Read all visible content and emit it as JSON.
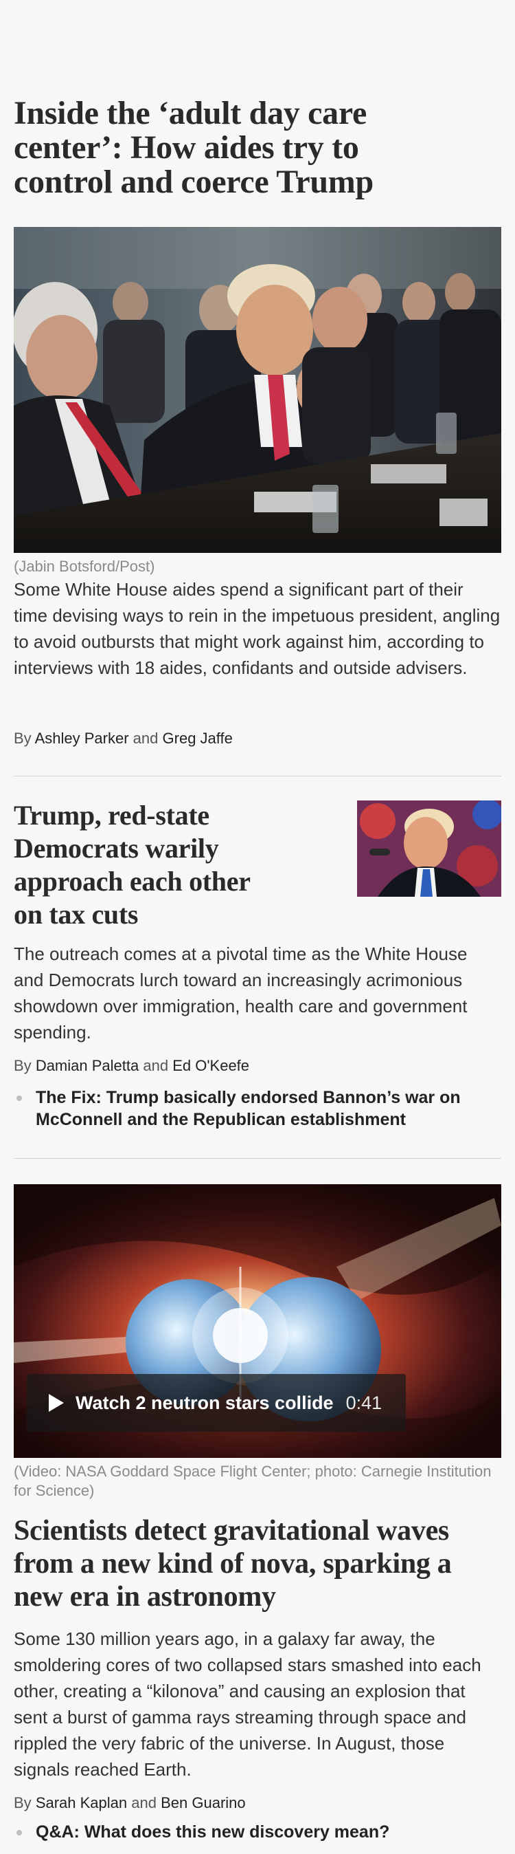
{
  "story1": {
    "headline": "Inside the ‘adult day care center’: How aides try to control and coerce Trump",
    "photo_caption": "(Jabin Botsford/Post)",
    "blurb": "Some White House aides spend a significant part of their time devising ways to rein in the impetuous president, angling to avoid outbursts that might work against him, according to interviews with 18 aides, confidants and outside advisers.",
    "byline_prefix": "By",
    "author1": "Ashley Parker",
    "conjunction": "and",
    "author2": "Greg Jaffe"
  },
  "story2": {
    "headline": "Trump, red-state Democrats warily approach each other on tax cuts",
    "blurb": "The outreach comes at a pivotal time as the White House and Democrats lurch toward an increasingly acrimonious showdown over immigration, health care and government spending.",
    "byline_prefix": "By",
    "author1": "Damian Paletta",
    "conjunction": "and",
    "author2": "Ed O'Keefe",
    "related": "The Fix: Trump basically endorsed Bannon’s war on McConnell and the Republican establishment"
  },
  "story3": {
    "video_title": "Watch 2 neutron stars collide",
    "video_duration": "0:41",
    "photo_caption": "(Video: NASA Goddard Space Flight Center; photo: Carnegie Institution for Science)",
    "headline": "Scientists detect gravitational waves from a new kind of nova, sparking a new era in astronomy",
    "blurb": "Some 130 million years ago, in a galaxy far away, the smoldering cores of two collapsed stars smashed into each other, creating a “kilonova” and causing an explosion that sent a burst of gamma rays streaming through space and rippled the very fabric of the universe. In August, those signals reached Earth.",
    "byline_prefix": "By",
    "author1": "Sarah Kaplan",
    "conjunction": "and",
    "author2": "Ben Guarino",
    "related": "Q&A: What does this new discovery mean?"
  },
  "icons": {
    "video_play": "play-icon",
    "related_bullet": "bullet-icon"
  }
}
